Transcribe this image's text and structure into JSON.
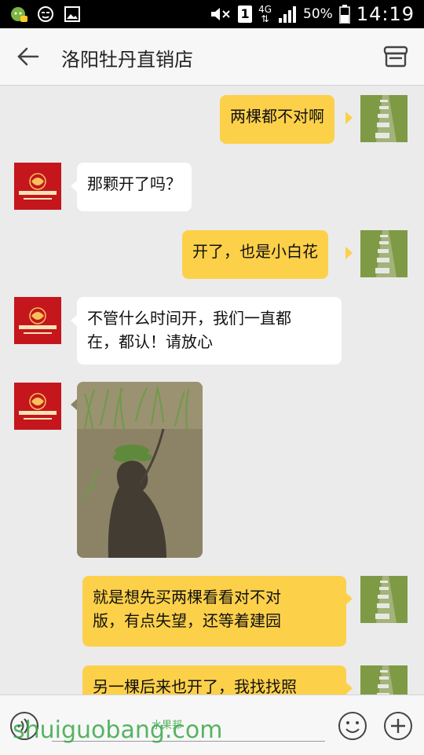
{
  "status_bar": {
    "battery": "50%",
    "time": "14:19",
    "network": "4G",
    "sim": "1"
  },
  "header": {
    "title": "洛阳牡丹直销店",
    "back_icon": "back-arrow-icon",
    "shop_icon": "storefront-icon"
  },
  "messages": [
    {
      "sender": "me",
      "type": "text",
      "lines": [
        "两棵都不对啊"
      ]
    },
    {
      "sender": "shop",
      "type": "text",
      "lines": [
        "那颗开了吗？"
      ]
    },
    {
      "sender": "me",
      "type": "text",
      "lines": [
        "开了，也是小白花"
      ]
    },
    {
      "sender": "shop",
      "type": "text",
      "lines": [
        "不管什么时间开，我们一直都",
        "在，都认！请放心"
      ]
    },
    {
      "sender": "shop",
      "type": "image",
      "image": "photo of ground with seedlings and shadow"
    },
    {
      "sender": "me",
      "type": "text",
      "lines": [
        "就是想先买两棵看看对不对",
        "版，有点失望，还等着建园"
      ]
    },
    {
      "sender": "me",
      "type": "text",
      "lines": [
        "另一棵后来也开了，我找找照"
      ]
    }
  ],
  "input_bar": {
    "voice_icon": "voice-icon",
    "emoji_icon": "emoji-icon",
    "plus_icon": "plus-icon"
  },
  "watermark": {
    "text": "shuiguobang.com",
    "small": "水果邦"
  },
  "colors": {
    "my_bubble": "#fdd04a",
    "other_bubble": "#ffffff",
    "background": "#ebebeb",
    "shop_avatar": "#c5161d"
  }
}
